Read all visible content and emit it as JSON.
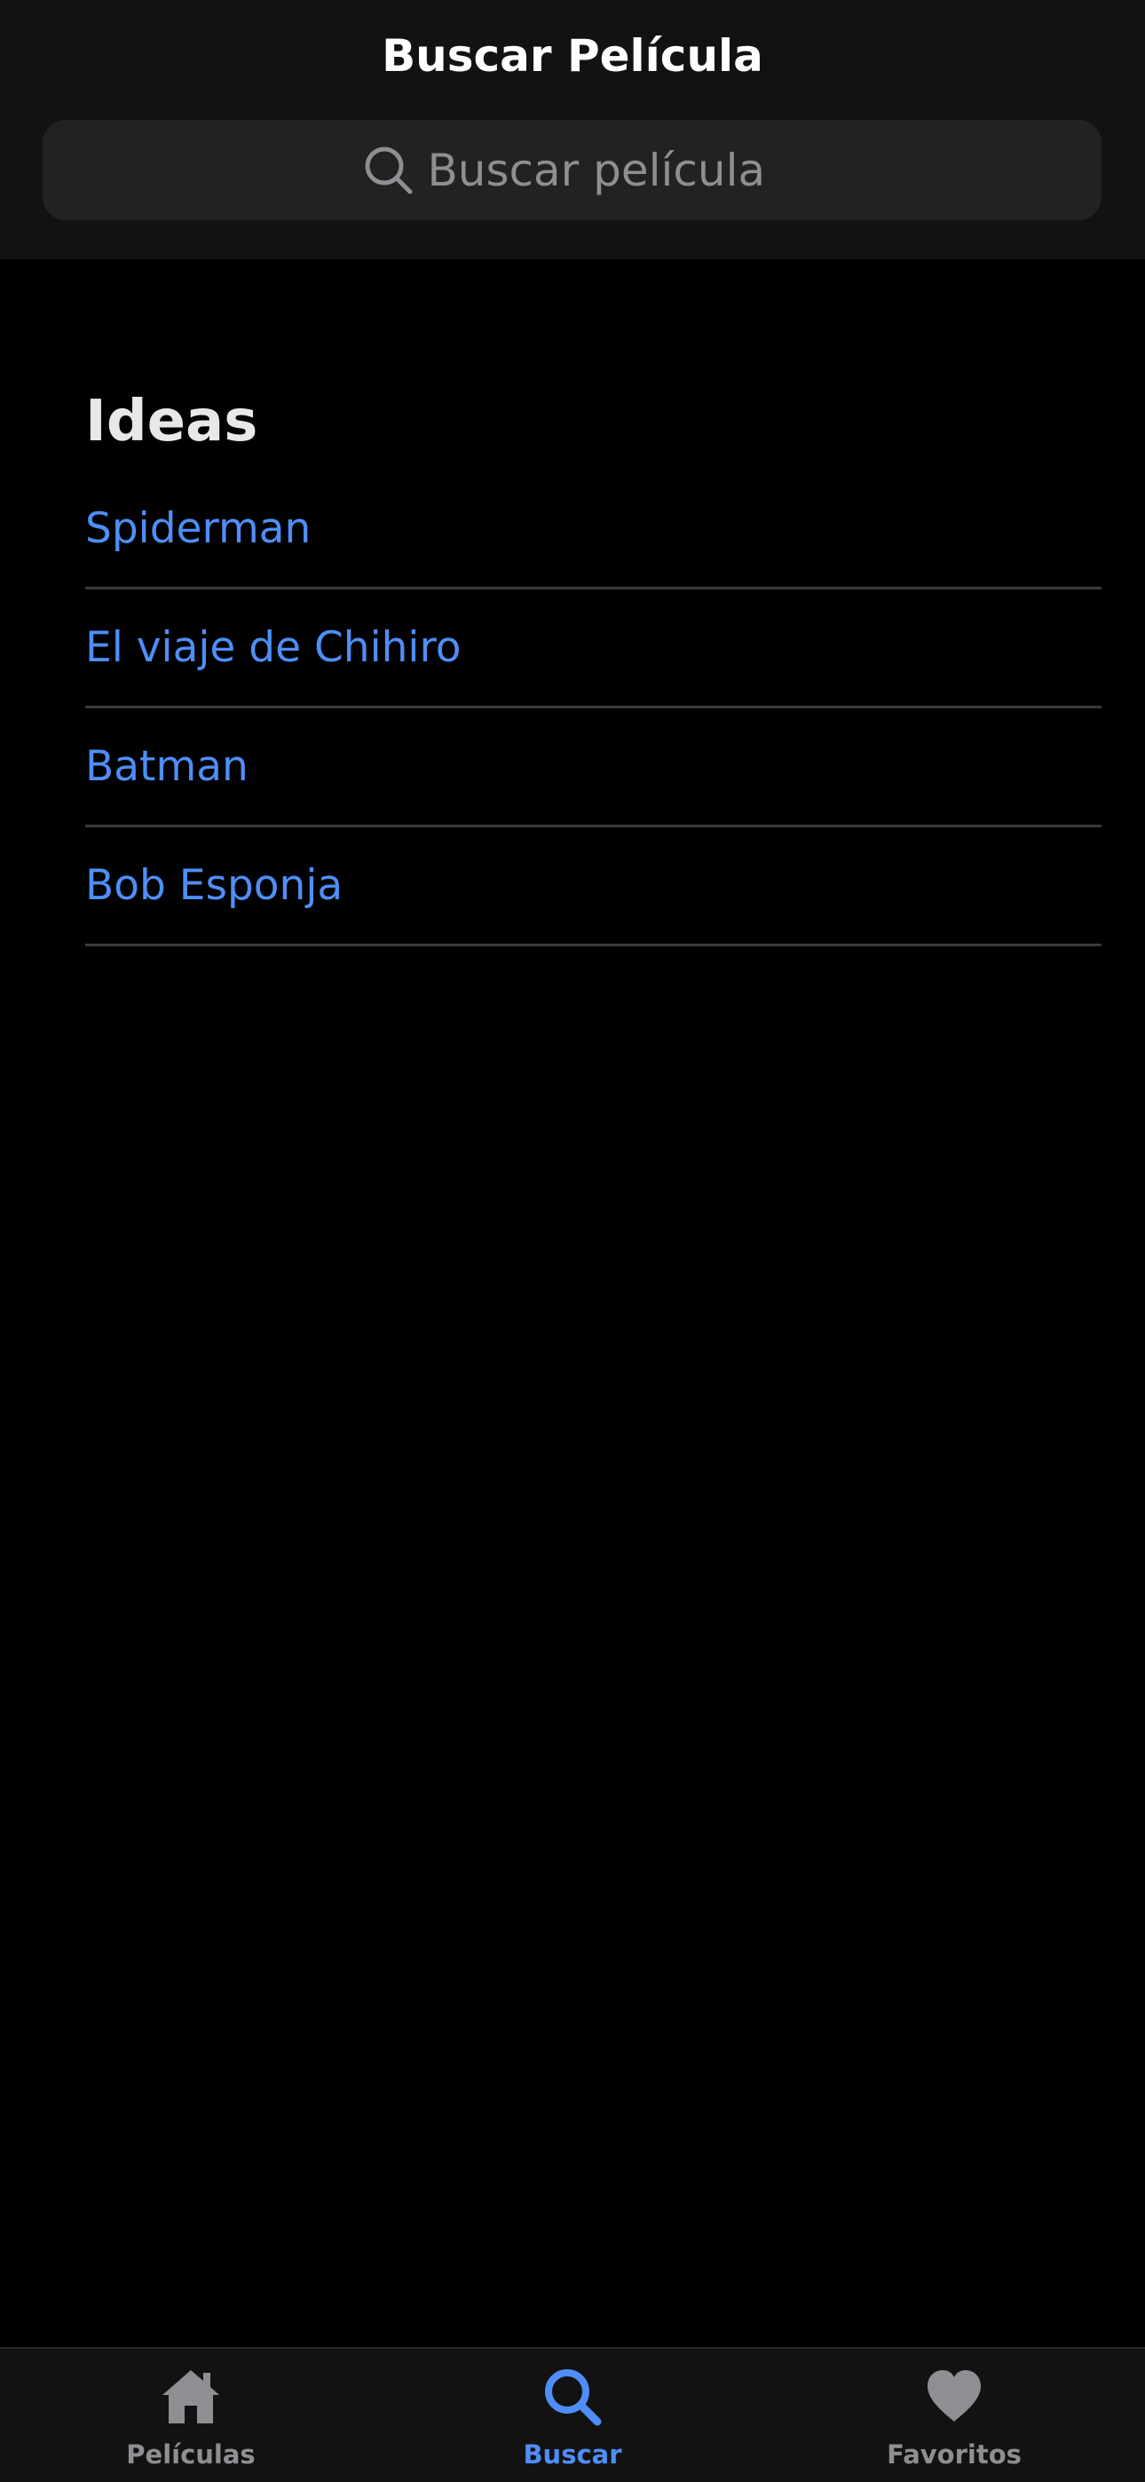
{
  "header": {
    "title": "Buscar Película"
  },
  "search": {
    "placeholder": "Buscar película",
    "value": "",
    "icon": "search-icon"
  },
  "ideas": {
    "title": "Ideas",
    "items": [
      {
        "label": "Spiderman"
      },
      {
        "label": "El viaje de Chihiro"
      },
      {
        "label": "Batman"
      },
      {
        "label": "Bob Esponja"
      }
    ]
  },
  "tabbar": {
    "tabs": [
      {
        "label": "Películas",
        "icon": "home-icon",
        "active": false
      },
      {
        "label": "Buscar",
        "icon": "search-icon",
        "active": true
      },
      {
        "label": "Favoritos",
        "icon": "heart-icon",
        "active": false
      }
    ]
  },
  "colors": {
    "background": "#000000",
    "header_background": "#121212",
    "search_background": "#222222",
    "accent": "#4f8ef7",
    "inactive": "#8e8e93",
    "divider": "#3a3a3c"
  }
}
